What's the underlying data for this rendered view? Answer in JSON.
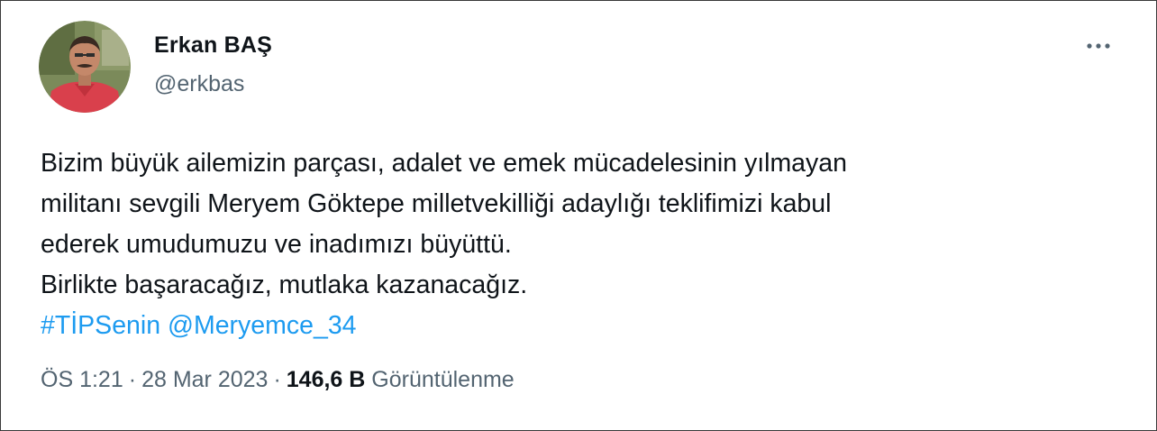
{
  "author": {
    "display_name": "Erkan BAŞ",
    "handle": "@erkbas"
  },
  "tweet": {
    "text_lines": [
      "Bizim büyük ailemizin parçası, adalet ve emek mücadelesinin yılmayan",
      "militanı sevgili Meryem Göktepe milletvekilliği adaylığı teklifimizi kabul",
      "ederek umudumuzu ve inadımızı büyüttü.",
      "Birlikte başaracağız, mutlaka kazanacağız."
    ],
    "hashtag": "#TİPSenin",
    "mention": "@Meryemce_34"
  },
  "meta": {
    "time": "ÖS 1:21",
    "separator": "·",
    "date": "28 Mar 2023",
    "views_count": "146,6 B",
    "views_label": "Görüntülenme"
  },
  "icons": {
    "more": "more-horizontal-icon",
    "avatar": "profile-photo"
  },
  "colors": {
    "link": "#1d9bf0",
    "secondary_text": "#536471",
    "primary_text": "#0f1419",
    "border": "#3a3a3a"
  }
}
